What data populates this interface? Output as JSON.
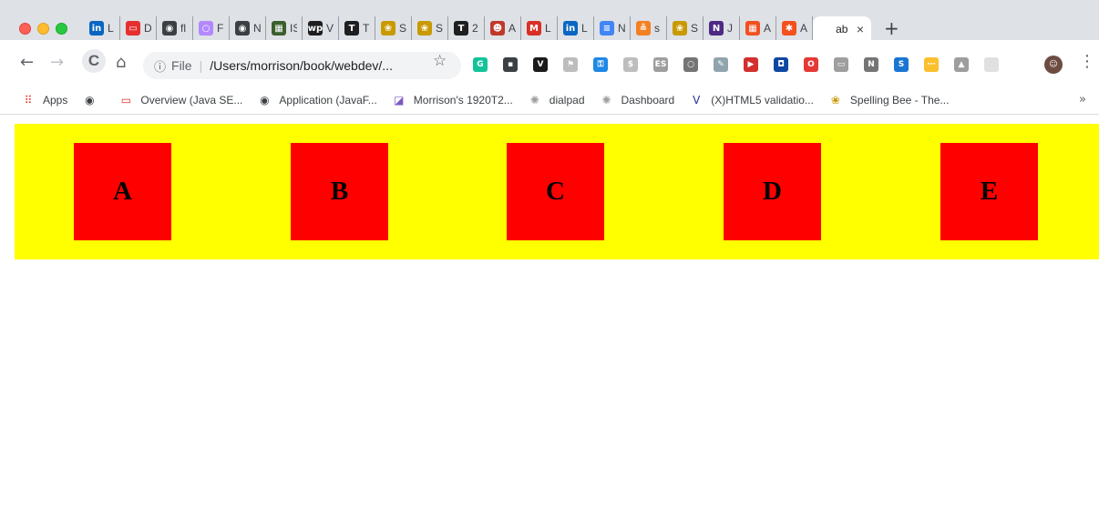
{
  "tabs": [
    {
      "icon": "linkedin-icon",
      "title": "L",
      "color": "#0a66c2",
      "glyph": "in"
    },
    {
      "icon": "oracle-icon",
      "title": "D",
      "color": "#e62e2e",
      "glyph": "▭"
    },
    {
      "icon": "globe-icon",
      "title": "fl",
      "color": "#3c4043",
      "glyph": "◉"
    },
    {
      "icon": "circle-icon",
      "title": "F",
      "color": "#b388ff",
      "glyph": "○"
    },
    {
      "icon": "globe-icon",
      "title": "N",
      "color": "#3c4043",
      "glyph": "◉"
    },
    {
      "icon": "isi-icon",
      "title": "IS",
      "color": "#3a5f2c",
      "glyph": "▦"
    },
    {
      "icon": "wp-icon",
      "title": "V",
      "color": "#1f1f1f",
      "glyph": "wp"
    },
    {
      "icon": "nyt-icon",
      "title": "T",
      "color": "#1f1f1f",
      "glyph": "T"
    },
    {
      "icon": "bee-icon",
      "title": "S",
      "color": "#c99a00",
      "glyph": "❀"
    },
    {
      "icon": "bee-icon",
      "title": "S",
      "color": "#c99a00",
      "glyph": "❀"
    },
    {
      "icon": "nyt-icon",
      "title": "2",
      "color": "#1f1f1f",
      "glyph": "T"
    },
    {
      "icon": "avatar-icon",
      "title": "A",
      "color": "#c0392b",
      "glyph": "☻"
    },
    {
      "icon": "gmail-icon",
      "title": "L",
      "color": "#d93025",
      "glyph": "M"
    },
    {
      "icon": "linkedin-icon",
      "title": "L",
      "color": "#0a66c2",
      "glyph": "in"
    },
    {
      "icon": "docs-icon",
      "title": "N",
      "color": "#4285f4",
      "glyph": "≡"
    },
    {
      "icon": "stackoverflow-icon",
      "title": "s",
      "color": "#f48024",
      "glyph": "≗"
    },
    {
      "icon": "bee-icon",
      "title": "S",
      "color": "#c99a00",
      "glyph": "❀"
    },
    {
      "icon": "northwestern-icon",
      "title": "J",
      "color": "#4e2a84",
      "glyph": "N"
    },
    {
      "icon": "microsoft-icon",
      "title": "A",
      "color": "#f25022",
      "glyph": "▦"
    },
    {
      "icon": "star-app-icon",
      "title": "A",
      "color": "#f4511e",
      "glyph": "✱"
    }
  ],
  "active_tab": {
    "title": "ab",
    "close": "×"
  },
  "new_tab": "+",
  "toolbar": {
    "back": "←",
    "forward": "→",
    "reload": "C",
    "home": "⌂",
    "info": "ⓘ",
    "scheme": "File",
    "separator": "|",
    "url": "/Users/morrison/book/webdev/...",
    "star": "☆",
    "menu": "⋮"
  },
  "extensions": [
    {
      "icon": "grammarly-icon",
      "color": "#15c39a",
      "glyph": "G"
    },
    {
      "icon": "ext-dark-icon",
      "color": "#3c4043",
      "glyph": "▪"
    },
    {
      "icon": "vimeo-icon",
      "color": "#1a1a1a",
      "glyph": "V"
    },
    {
      "icon": "shield-icon",
      "color": "#bdbdbd",
      "glyph": "⚑"
    },
    {
      "icon": "key-icon",
      "color": "#1e88e5",
      "glyph": "⚿"
    },
    {
      "icon": "dollar-icon",
      "color": "#bdbdbd",
      "glyph": "$"
    },
    {
      "icon": "es-icon",
      "color": "#9e9e9e",
      "glyph": "ES"
    },
    {
      "icon": "ring-icon",
      "color": "#757575",
      "glyph": "○"
    },
    {
      "icon": "pen-icon",
      "color": "#90a4ae",
      "glyph": "✎"
    },
    {
      "icon": "play-icon",
      "color": "#d32f2f",
      "glyph": "▶"
    },
    {
      "icon": "chat-icon",
      "color": "#0d47a1",
      "glyph": "◘"
    },
    {
      "icon": "opera-icon",
      "color": "#e53935",
      "glyph": "O"
    },
    {
      "icon": "tablet-icon",
      "color": "#9e9e9e",
      "glyph": "▭"
    },
    {
      "icon": "notion-icon",
      "color": "#757575",
      "glyph": "N"
    },
    {
      "icon": "s-icon",
      "color": "#1976d2",
      "glyph": "S"
    },
    {
      "icon": "sticky-icon",
      "color": "#fbc02d",
      "glyph": "⋯"
    },
    {
      "icon": "drive-icon",
      "color": "#9e9e9e",
      "glyph": "▲"
    },
    {
      "icon": "blank-icon",
      "color": "#e0e0e0",
      "glyph": ""
    },
    {
      "icon": "profile-avatar-icon",
      "color": "#6d4c41",
      "glyph": "☺"
    }
  ],
  "bookmarks": [
    {
      "icon": "apps-grid-icon",
      "label": "Apps",
      "color": "#ea4335",
      "glyph": "⠿"
    },
    {
      "icon": "globe-icon",
      "label": "",
      "color": "#3c4043",
      "glyph": "◉"
    },
    {
      "icon": "oracle-icon",
      "label": "Overview (Java SE...",
      "color": "#e62e2e",
      "glyph": "▭"
    },
    {
      "icon": "globe-icon",
      "label": "Application (JavaF...",
      "color": "#3c4043",
      "glyph": "◉"
    },
    {
      "icon": "calendar-app-icon",
      "label": "Morrison's 1920T2...",
      "color": "#7e57c2",
      "glyph": "◪"
    },
    {
      "icon": "dialpad-icon",
      "label": "dialpad",
      "color": "#9e9e9e",
      "glyph": "✺"
    },
    {
      "icon": "dashboard-icon",
      "label": "Dashboard",
      "color": "#9e9e9e",
      "glyph": "✺"
    },
    {
      "icon": "w3c-icon",
      "label": "(X)HTML5 validatio...",
      "color": "#283593",
      "glyph": "V"
    },
    {
      "icon": "bee-icon",
      "label": "Spelling Bee - The...",
      "color": "#c99a00",
      "glyph": "❀"
    }
  ],
  "bookmarks_more": "»",
  "page": {
    "banner_color": "#ffff00",
    "box_color": "#ff0000",
    "boxes": [
      "A",
      "B",
      "C",
      "D",
      "E"
    ]
  }
}
